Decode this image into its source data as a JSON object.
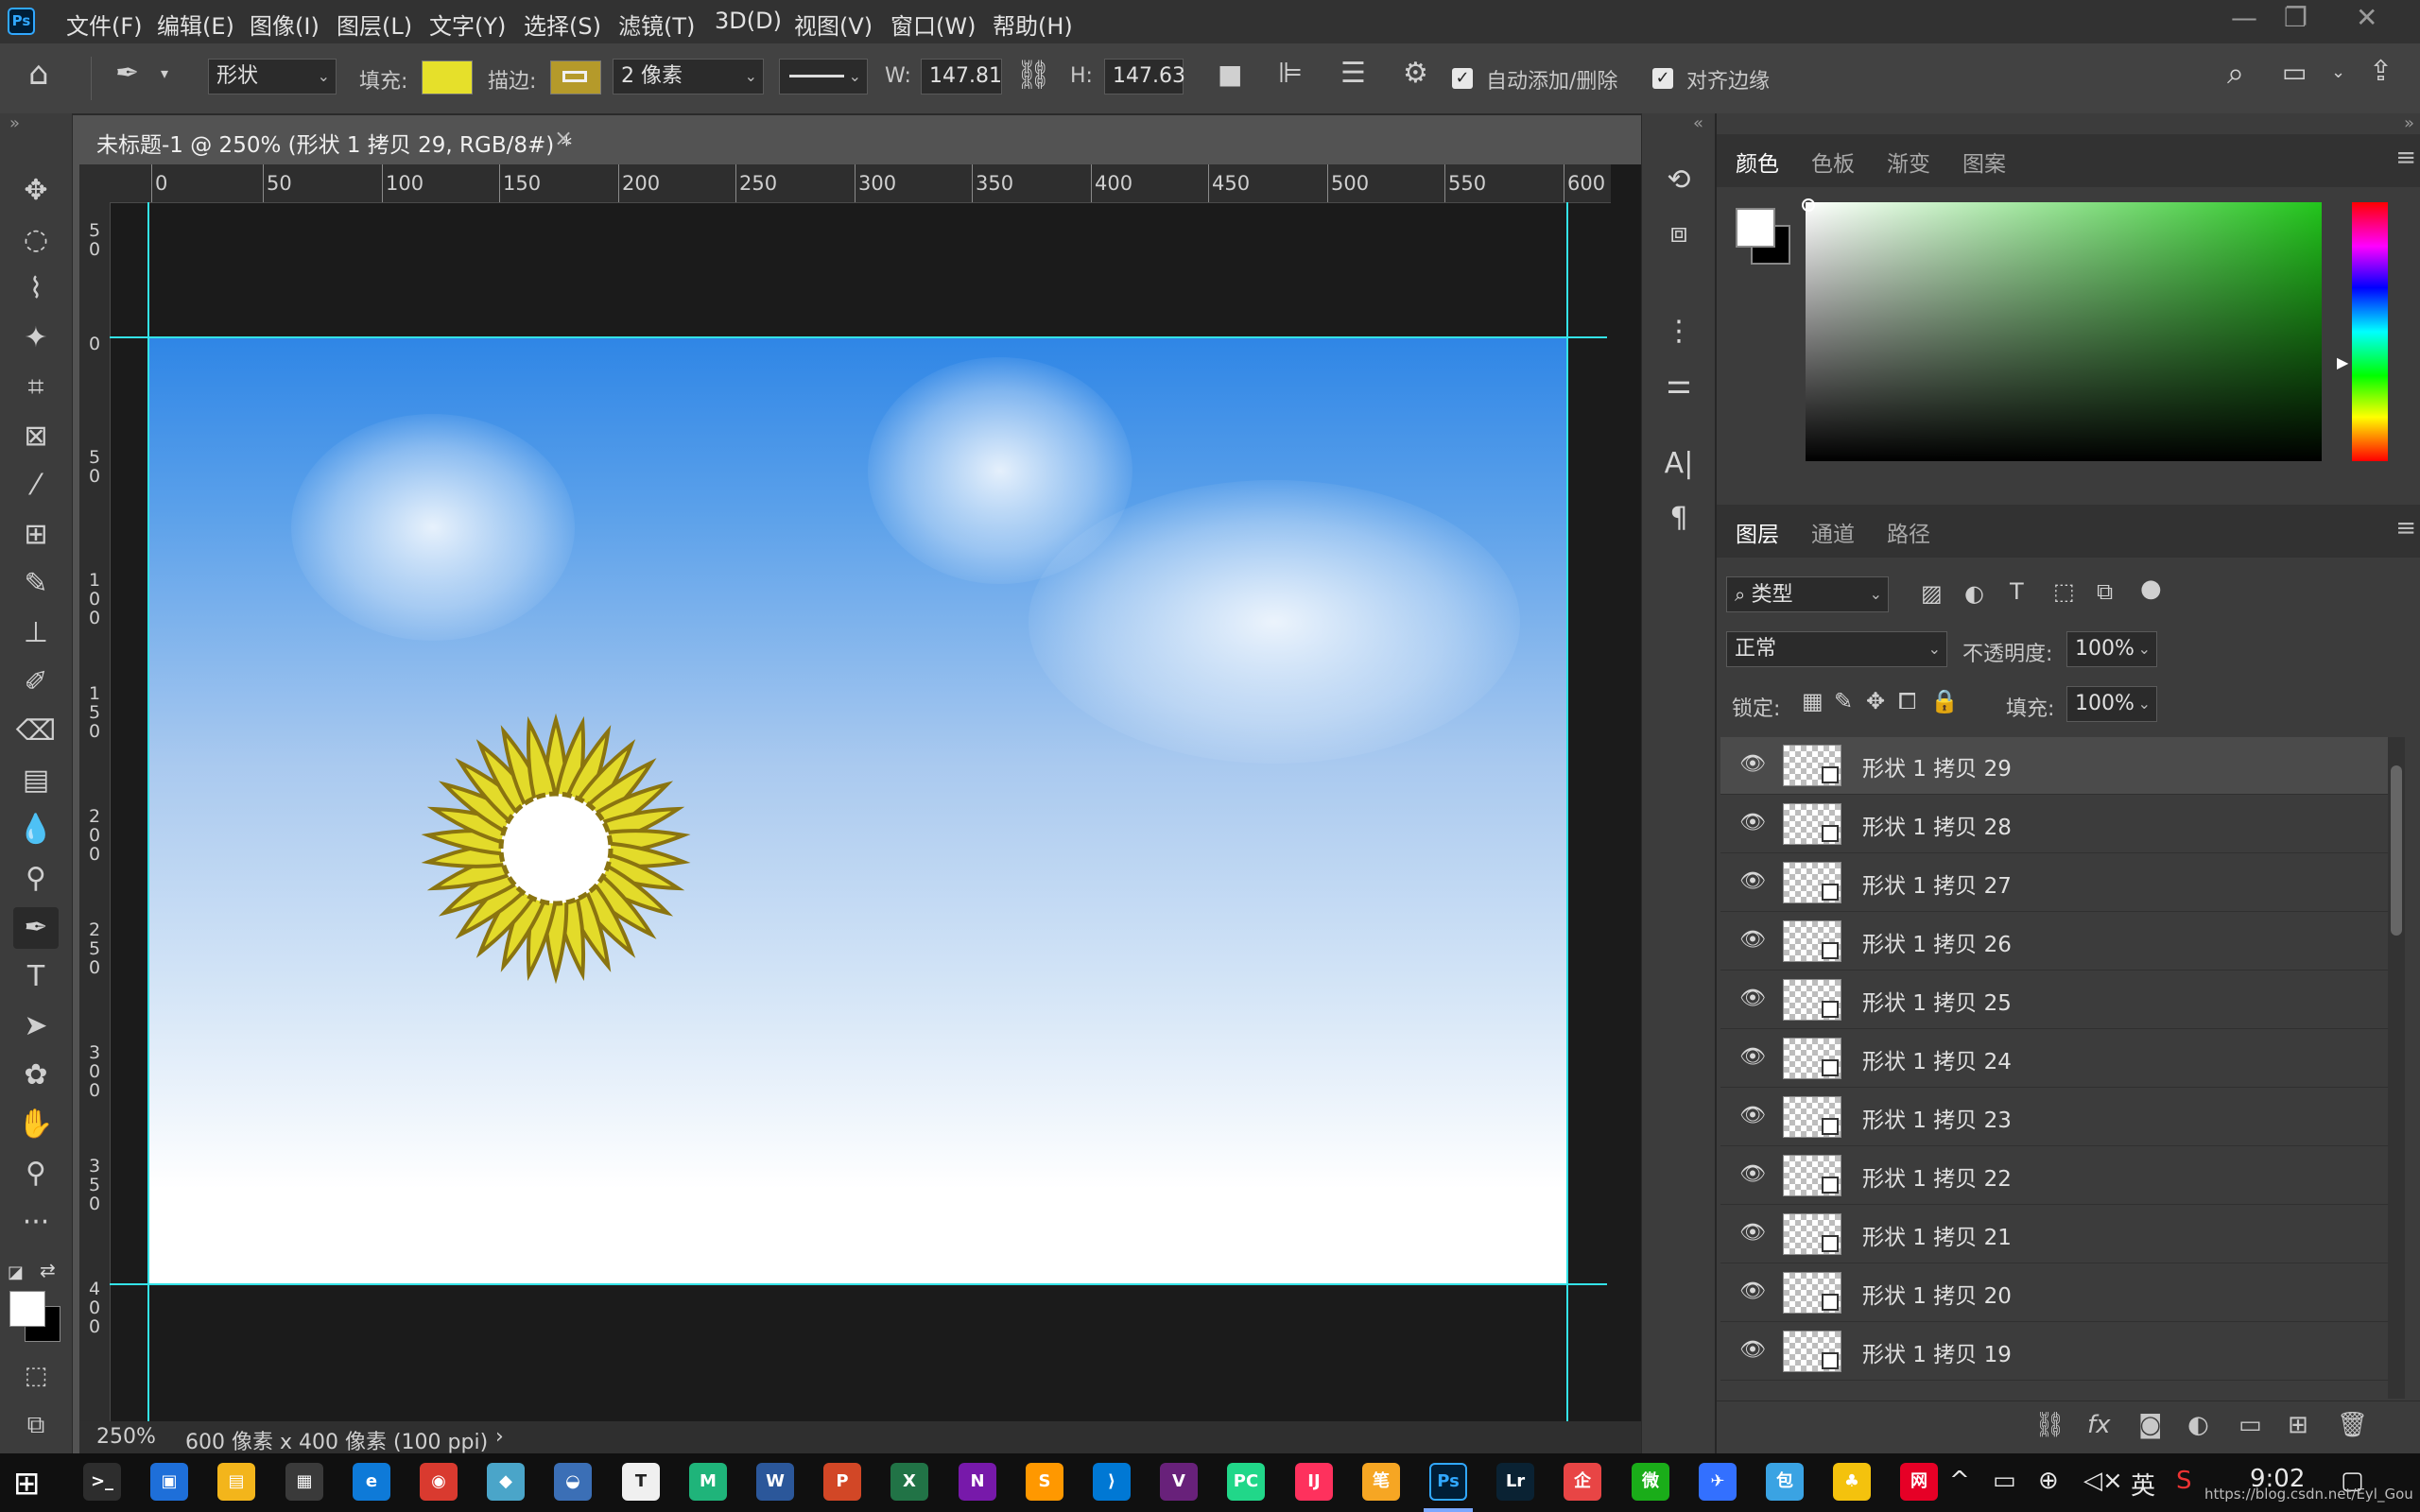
{
  "app": {
    "logo": "Ps",
    "brand_color": "#31a8ff"
  },
  "menu": [
    "文件(F)",
    "编辑(E)",
    "图像(I)",
    "图层(L)",
    "文字(Y)",
    "选择(S)",
    "滤镜(T)",
    "3D(D)",
    "视图(V)",
    "窗口(W)",
    "帮助(H)"
  ],
  "window_controls": {
    "minimize": "—",
    "restore": "❐",
    "close": "✕"
  },
  "options": {
    "mode": "形状",
    "fill_label": "填充:",
    "fill_color": "#e6e02a",
    "stroke_label": "描边:",
    "stroke_color": "#b59a2a",
    "stroke_width": "2 像素",
    "w_label": "W:",
    "w_value": "147.81",
    "h_label": "H:",
    "h_value": "147.63",
    "auto_add_delete": "自动添加/删除",
    "auto_add_delete_checked": true,
    "align_edges": "对齐边缘",
    "align_edges_checked": true
  },
  "document": {
    "tab_title": "未标题-1 @ 250% (形状 1 拷贝 29, RGB/8#) *",
    "close": "×",
    "zoom": "250%",
    "doc_info": "600 像素 x 400 像素 (100 ppi)",
    "status_arrow": "›"
  },
  "ruler": {
    "top_labels": [
      "0",
      "50",
      "100",
      "150",
      "200",
      "250",
      "300",
      "350",
      "400",
      "450",
      "500",
      "550",
      "600"
    ],
    "left_labels": [
      "5 0",
      "0",
      "5 0",
      "1 0 0",
      "1 5 0",
      "2 0 0",
      "2 5 0",
      "3 0 0",
      "3 5 0",
      "4 0 0"
    ]
  },
  "panels": {
    "color_tabs": [
      "颜色",
      "色板",
      "渐变",
      "图案"
    ],
    "fg_color": "#ffffff",
    "bg_color": "#000000",
    "layers_tabs": [
      "图层",
      "通道",
      "路径"
    ],
    "filter_kind": "类型",
    "blend_mode": "正常",
    "opacity_label": "不透明度:",
    "opacity_value": "100%",
    "lock_label": "锁定:",
    "fill_label": "填充:",
    "fill_value": "100%",
    "layers": [
      {
        "name": "形状 1 拷贝 29",
        "selected": true
      },
      {
        "name": "形状 1 拷贝 28",
        "selected": false
      },
      {
        "name": "形状 1 拷贝 27",
        "selected": false
      },
      {
        "name": "形状 1 拷贝 26",
        "selected": false
      },
      {
        "name": "形状 1 拷贝 25",
        "selected": false
      },
      {
        "name": "形状 1 拷贝 24",
        "selected": false
      },
      {
        "name": "形状 1 拷贝 23",
        "selected": false
      },
      {
        "name": "形状 1 拷贝 22",
        "selected": false
      },
      {
        "name": "形状 1 拷贝 21",
        "selected": false
      },
      {
        "name": "形状 1 拷贝 20",
        "selected": false
      },
      {
        "name": "形状 1 拷贝 19",
        "selected": false
      }
    ]
  },
  "taskbar": {
    "apps": [
      {
        "label": ">_",
        "icon": "terminal-icon",
        "color": "#2d2d2d"
      },
      {
        "label": "▣",
        "icon": "remote-desktop-icon",
        "color": "#1e6fd9"
      },
      {
        "label": "▤",
        "icon": "file-explorer-icon",
        "color": "#f3b51b"
      },
      {
        "label": "▦",
        "icon": "calculator-icon",
        "color": "#3a3a3a"
      },
      {
        "label": "e",
        "icon": "edge-icon",
        "color": "#0e7ad8"
      },
      {
        "label": "◉",
        "icon": "chrome-icon",
        "color": "#d93a2f"
      },
      {
        "label": "◆",
        "icon": "app-icon",
        "color": "#4aa5c9"
      },
      {
        "label": "◒",
        "icon": "paint-icon",
        "color": "#3b6fb6"
      },
      {
        "label": "T",
        "icon": "typora-icon",
        "color": "#f0f0f0"
      },
      {
        "label": "M",
        "icon": "mindmaster-icon",
        "color": "#1fb47a"
      },
      {
        "label": "W",
        "icon": "word-icon",
        "color": "#2b579a"
      },
      {
        "label": "P",
        "icon": "powerpoint-icon",
        "color": "#d24726"
      },
      {
        "label": "X",
        "icon": "excel-icon",
        "color": "#217346"
      },
      {
        "label": "N",
        "icon": "onenote-icon",
        "color": "#7719aa"
      },
      {
        "label": "S",
        "icon": "sublime-icon",
        "color": "#ff9800"
      },
      {
        "label": "⟩",
        "icon": "vscode-icon",
        "color": "#0078d4"
      },
      {
        "label": "V",
        "icon": "visual-studio-icon",
        "color": "#68217a"
      },
      {
        "label": "PC",
        "icon": "pycharm-icon",
        "color": "#21d789"
      },
      {
        "label": "IJ",
        "icon": "intellij-icon",
        "color": "#fe315d"
      },
      {
        "label": "笔",
        "icon": "notes-icon",
        "color": "#f6a623"
      },
      {
        "label": "Ps",
        "icon": "photoshop-icon",
        "color": "#001e36"
      },
      {
        "label": "Lr",
        "icon": "lightroom-icon",
        "color": "#0a2233"
      },
      {
        "label": "企",
        "icon": "qq-icon",
        "color": "#e84545"
      },
      {
        "label": "微",
        "icon": "wechat-icon",
        "color": "#1aad19"
      },
      {
        "label": "✈",
        "icon": "feishu-icon",
        "color": "#3370ff"
      },
      {
        "label": "包",
        "icon": "bag-icon",
        "color": "#3aa3e3"
      },
      {
        "label": "♣",
        "icon": "app2-icon",
        "color": "#f4c20d"
      },
      {
        "label": "网",
        "icon": "netease-music-icon",
        "color": "#e60026"
      }
    ],
    "tray": {
      "chevron": "^",
      "lang": "英",
      "time": "9:02",
      "notification": "▢",
      "watermark": "https://blog.csdn.net/Eyl_Gou"
    }
  }
}
